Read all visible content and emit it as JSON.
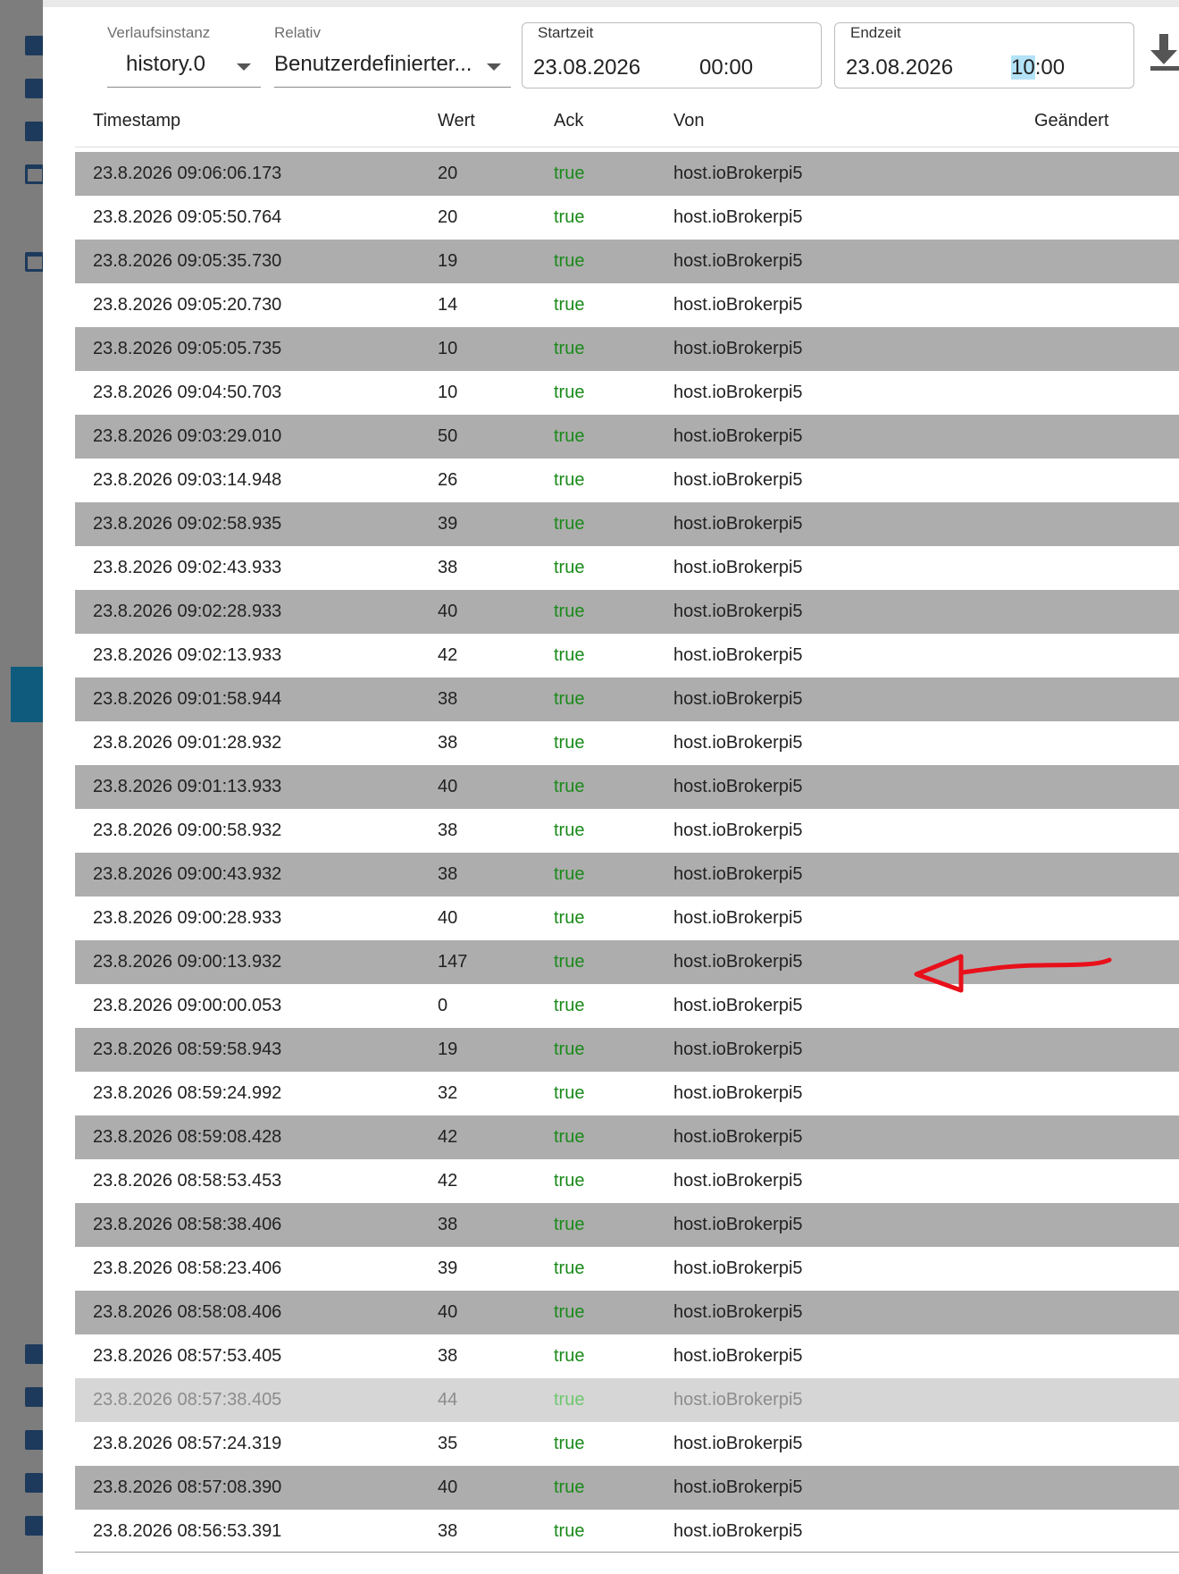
{
  "toolbar": {
    "instance_label": "Verlaufsinstanz",
    "instance_value": "history.0",
    "relative_label": "Relativ",
    "relative_value": "Benutzerdefinierter...",
    "start_label": "Startzeit",
    "start_date": "23.08.2026",
    "start_time": "00:00",
    "end_label": "Endzeit",
    "end_date": "23.08.2026",
    "end_time_hour": "10",
    "end_time_rest": ":00"
  },
  "table": {
    "columns": [
      "Timestamp",
      "Wert",
      "Ack",
      "Von",
      "Geändert"
    ],
    "rows": [
      {
        "ts": "23.8.2026 09:06:06.173",
        "val": "20",
        "ack": "true",
        "from": "host.ioBrokerpi5"
      },
      {
        "ts": "23.8.2026 09:05:50.764",
        "val": "20",
        "ack": "true",
        "from": "host.ioBrokerpi5"
      },
      {
        "ts": "23.8.2026 09:05:35.730",
        "val": "19",
        "ack": "true",
        "from": "host.ioBrokerpi5"
      },
      {
        "ts": "23.8.2026 09:05:20.730",
        "val": "14",
        "ack": "true",
        "from": "host.ioBrokerpi5"
      },
      {
        "ts": "23.8.2026 09:05:05.735",
        "val": "10",
        "ack": "true",
        "from": "host.ioBrokerpi5"
      },
      {
        "ts": "23.8.2026 09:04:50.703",
        "val": "10",
        "ack": "true",
        "from": "host.ioBrokerpi5"
      },
      {
        "ts": "23.8.2026 09:03:29.010",
        "val": "50",
        "ack": "true",
        "from": "host.ioBrokerpi5"
      },
      {
        "ts": "23.8.2026 09:03:14.948",
        "val": "26",
        "ack": "true",
        "from": "host.ioBrokerpi5"
      },
      {
        "ts": "23.8.2026 09:02:58.935",
        "val": "39",
        "ack": "true",
        "from": "host.ioBrokerpi5"
      },
      {
        "ts": "23.8.2026 09:02:43.933",
        "val": "38",
        "ack": "true",
        "from": "host.ioBrokerpi5"
      },
      {
        "ts": "23.8.2026 09:02:28.933",
        "val": "40",
        "ack": "true",
        "from": "host.ioBrokerpi5"
      },
      {
        "ts": "23.8.2026 09:02:13.933",
        "val": "42",
        "ack": "true",
        "from": "host.ioBrokerpi5"
      },
      {
        "ts": "23.8.2026 09:01:58.944",
        "val": "38",
        "ack": "true",
        "from": "host.ioBrokerpi5"
      },
      {
        "ts": "23.8.2026 09:01:28.932",
        "val": "38",
        "ack": "true",
        "from": "host.ioBrokerpi5"
      },
      {
        "ts": "23.8.2026 09:01:13.933",
        "val": "40",
        "ack": "true",
        "from": "host.ioBrokerpi5"
      },
      {
        "ts": "23.8.2026 09:00:58.932",
        "val": "38",
        "ack": "true",
        "from": "host.ioBrokerpi5"
      },
      {
        "ts": "23.8.2026 09:00:43.932",
        "val": "38",
        "ack": "true",
        "from": "host.ioBrokerpi5"
      },
      {
        "ts": "23.8.2026 09:00:28.933",
        "val": "40",
        "ack": "true",
        "from": "host.ioBrokerpi5"
      },
      {
        "ts": "23.8.2026 09:00:13.932",
        "val": "147",
        "ack": "true",
        "from": "host.ioBrokerpi5"
      },
      {
        "ts": "23.8.2026 09:00:00.053",
        "val": "0",
        "ack": "true",
        "from": "host.ioBrokerpi5"
      },
      {
        "ts": "23.8.2026 08:59:58.943",
        "val": "19",
        "ack": "true",
        "from": "host.ioBrokerpi5"
      },
      {
        "ts": "23.8.2026 08:59:24.992",
        "val": "32",
        "ack": "true",
        "from": "host.ioBrokerpi5"
      },
      {
        "ts": "23.8.2026 08:59:08.428",
        "val": "42",
        "ack": "true",
        "from": "host.ioBrokerpi5"
      },
      {
        "ts": "23.8.2026 08:58:53.453",
        "val": "42",
        "ack": "true",
        "from": "host.ioBrokerpi5"
      },
      {
        "ts": "23.8.2026 08:58:38.406",
        "val": "38",
        "ack": "true",
        "from": "host.ioBrokerpi5"
      },
      {
        "ts": "23.8.2026 08:58:23.406",
        "val": "39",
        "ack": "true",
        "from": "host.ioBrokerpi5"
      },
      {
        "ts": "23.8.2026 08:58:08.406",
        "val": "40",
        "ack": "true",
        "from": "host.ioBrokerpi5"
      },
      {
        "ts": "23.8.2026 08:57:53.405",
        "val": "38",
        "ack": "true",
        "from": "host.ioBrokerpi5"
      },
      {
        "ts": "23.8.2026 08:57:38.405",
        "val": "44",
        "ack": "true",
        "from": "host.ioBrokerpi5",
        "highlighted": true
      },
      {
        "ts": "23.8.2026 08:57:24.319",
        "val": "35",
        "ack": "true",
        "from": "host.ioBrokerpi5"
      },
      {
        "ts": "23.8.2026 08:57:08.390",
        "val": "40",
        "ack": "true",
        "from": "host.ioBrokerpi5"
      },
      {
        "ts": "23.8.2026 08:56:53.391",
        "val": "38",
        "ack": "true",
        "from": "host.ioBrokerpi5"
      }
    ]
  },
  "colors": {
    "row_shade": "#adadad",
    "ack_true": "#1a8a1a",
    "annotation": "#e8101a"
  },
  "icons": {
    "download": "download-icon",
    "dropdown": "chevron-down-icon",
    "folder": "folder-icon"
  }
}
